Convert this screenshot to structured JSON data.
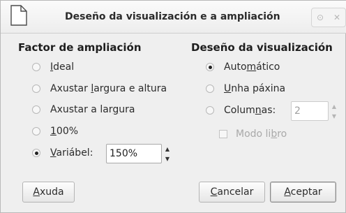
{
  "window": {
    "title": "Deseño da visualización e a ampliación",
    "restore_glyph": "⊙",
    "close_glyph": "✕"
  },
  "zoom": {
    "heading": "Factor de ampliación",
    "options": [
      {
        "id": "ideal",
        "pre": "",
        "mn": "I",
        "post": "deal",
        "selected": false
      },
      {
        "id": "fit-both",
        "pre": "Axustar ",
        "mn": "l",
        "post": "argura e altura",
        "selected": false
      },
      {
        "id": "fit-width",
        "pre": "Axustar a lar",
        "mn": "g",
        "post": "ura",
        "selected": false
      },
      {
        "id": "100",
        "pre": "",
        "mn": "1",
        "post": "00%",
        "selected": false
      },
      {
        "id": "variable",
        "pre": "",
        "mn": "V",
        "post": "ariábel:",
        "selected": true
      }
    ],
    "variable_value": "150%"
  },
  "layout": {
    "heading": "Deseño da visualización",
    "options": [
      {
        "id": "auto",
        "pre": "Auto",
        "mn": "m",
        "post": "ático",
        "selected": true
      },
      {
        "id": "single",
        "pre": "",
        "mn": "U",
        "post": "nha páxina",
        "selected": false
      },
      {
        "id": "columns",
        "pre": "Colum",
        "mn": "n",
        "post": "as:",
        "selected": false
      }
    ],
    "columns_value": "2",
    "book_mode": {
      "pre": "Modo li",
      "mn": "b",
      "post": "ro",
      "checked": false
    }
  },
  "buttons": {
    "help": {
      "pre": "",
      "mn": "A",
      "post": "xuda"
    },
    "cancel": {
      "pre": "",
      "mn": "C",
      "post": "ancelar"
    },
    "ok": {
      "pre": "",
      "mn": "A",
      "post": "ceptar"
    }
  }
}
